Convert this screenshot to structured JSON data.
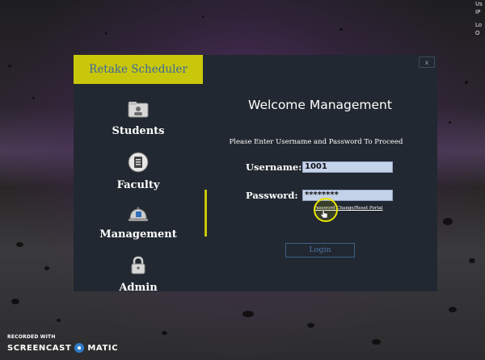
{
  "desktop": {
    "edge_text": [
      "Us",
      "IP",
      "Lo",
      "O"
    ]
  },
  "window": {
    "close_glyph": "x"
  },
  "brand": {
    "title": "Retake Scheduler",
    "accent_color": "#c9c70a"
  },
  "sidebar": {
    "items": [
      {
        "label": "Students",
        "icon": "folder-icon",
        "active": false
      },
      {
        "label": "Faculty",
        "icon": "clipboard-icon",
        "active": false
      },
      {
        "label": "Management",
        "icon": "bell-icon",
        "active": true
      },
      {
        "label": "Admin",
        "icon": "lock-icon",
        "active": false
      }
    ]
  },
  "login": {
    "heading": "Welcome Management",
    "instruction": "Please Enter Username and Password To Proceed",
    "username_label": "Username:",
    "username_value": "1001",
    "password_label": "Password:",
    "password_value": "********",
    "reset_link": "Password Change/Reset Portal",
    "login_button": "Login"
  },
  "watermark": {
    "recorded_with": "RECORDED WITH",
    "brand_left": "SCREENCAST",
    "brand_right": "MATIC"
  }
}
